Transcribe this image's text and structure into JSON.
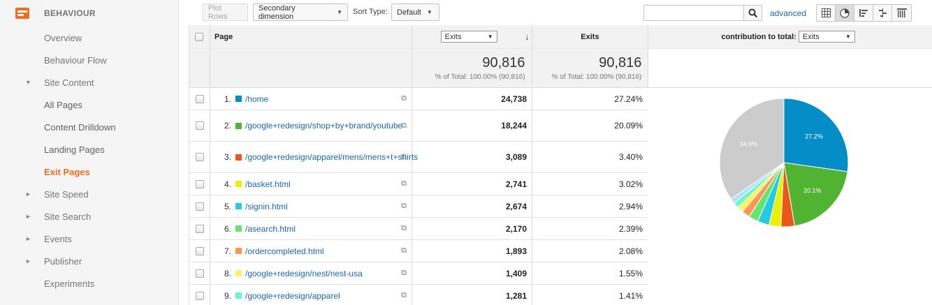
{
  "sidebar": {
    "section_title": "BEHAVIOUR",
    "items": [
      {
        "label": "Overview",
        "arrow": ""
      },
      {
        "label": "Behaviour Flow",
        "arrow": ""
      },
      {
        "label": "Site Content",
        "arrow": "▼"
      },
      {
        "label": "All Pages",
        "arrow": ""
      },
      {
        "label": "Content Drilldown",
        "arrow": ""
      },
      {
        "label": "Landing Pages",
        "arrow": ""
      },
      {
        "label": "Exit Pages",
        "arrow": ""
      },
      {
        "label": "Site Speed",
        "arrow": "►"
      },
      {
        "label": "Site Search",
        "arrow": "►"
      },
      {
        "label": "Events",
        "arrow": "►"
      },
      {
        "label": "Publisher",
        "arrow": "►"
      },
      {
        "label": "Experiments",
        "arrow": ""
      }
    ]
  },
  "toolbar": {
    "plot_rows": "Plot Rows",
    "secondary_dimension": "Secondary dimension",
    "sort_type_label": "Sort Type:",
    "sort_type_value": "Default",
    "advanced": "advanced"
  },
  "table": {
    "col_page": "Page",
    "col_metric_select": "Exits",
    "col_exits": "Exits",
    "contribution_label": "contribution to total:",
    "contribution_select": "Exits",
    "summary": {
      "total1": "90,816",
      "pct1": "% of Total: 100.00% (90,816)",
      "total2": "90,816",
      "pct2": "% of Total: 100.00% (90,816)"
    },
    "rows": [
      {
        "rank": "1.",
        "page": "/home",
        "exits": "24,738",
        "pct": "27.24%",
        "color": "#058dc7"
      },
      {
        "rank": "2.",
        "page": "/google+redesign/shop+by+brand/youtube",
        "exits": "18,244",
        "pct": "20.09%",
        "color": "#50b432"
      },
      {
        "rank": "3.",
        "page": "/google+redesign/apparel/mens/mens+t+shirts",
        "exits": "3,089",
        "pct": "3.40%",
        "color": "#ed561b"
      },
      {
        "rank": "4.",
        "page": "/basket.html",
        "exits": "2,741",
        "pct": "3.02%",
        "color": "#edef00"
      },
      {
        "rank": "5.",
        "page": "/signin.html",
        "exits": "2,674",
        "pct": "2.94%",
        "color": "#24cbe5"
      },
      {
        "rank": "6.",
        "page": "/asearch.html",
        "exits": "2,170",
        "pct": "2.39%",
        "color": "#64e572"
      },
      {
        "rank": "7.",
        "page": "/ordercompleted.html",
        "exits": "1,893",
        "pct": "2.08%",
        "color": "#ff9655"
      },
      {
        "rank": "8.",
        "page": "/google+redesign/nest/nest-usa",
        "exits": "1,409",
        "pct": "1.55%",
        "color": "#fff263"
      },
      {
        "rank": "9.",
        "page": "/google+redesign/apparel",
        "exits": "1,281",
        "pct": "1.41%",
        "color": "#6af9c4"
      }
    ]
  },
  "chart_data": {
    "type": "pie",
    "slices": [
      {
        "value": 27.24,
        "label": "27.2%",
        "color": "#058dc7"
      },
      {
        "value": 20.09,
        "label": "20.1%",
        "color": "#50b432"
      },
      {
        "value": 3.4,
        "label": "",
        "color": "#ed561b"
      },
      {
        "value": 3.02,
        "label": "",
        "color": "#edef00"
      },
      {
        "value": 2.94,
        "label": "",
        "color": "#24cbe5"
      },
      {
        "value": 2.39,
        "label": "",
        "color": "#64e572"
      },
      {
        "value": 2.08,
        "label": "",
        "color": "#ff9655"
      },
      {
        "value": 1.55,
        "label": "",
        "color": "#fff263"
      },
      {
        "value": 1.41,
        "label": "",
        "color": "#6af9c4"
      },
      {
        "value": 1.28,
        "label": "",
        "color": "#b2deff"
      },
      {
        "value": 34.6,
        "label": "34.6%",
        "color": "#cccccc"
      }
    ]
  }
}
